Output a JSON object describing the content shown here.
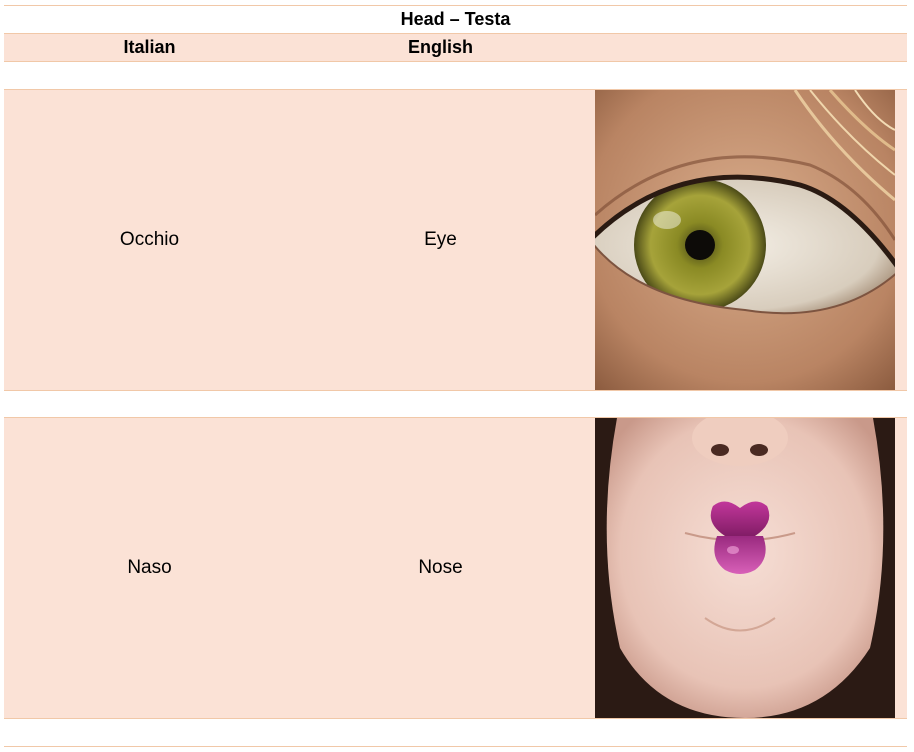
{
  "title": "Head – Testa",
  "columns": {
    "italian": "Italian",
    "english": "English"
  },
  "rows": [
    {
      "italian": "Occhio",
      "english": "Eye",
      "image": "eye-photo"
    },
    {
      "italian": "Naso",
      "english": "Nose",
      "image": "lips-photo"
    }
  ],
  "colors": {
    "row_fill": "#fbe2d6",
    "border": "#f1c8a8"
  }
}
